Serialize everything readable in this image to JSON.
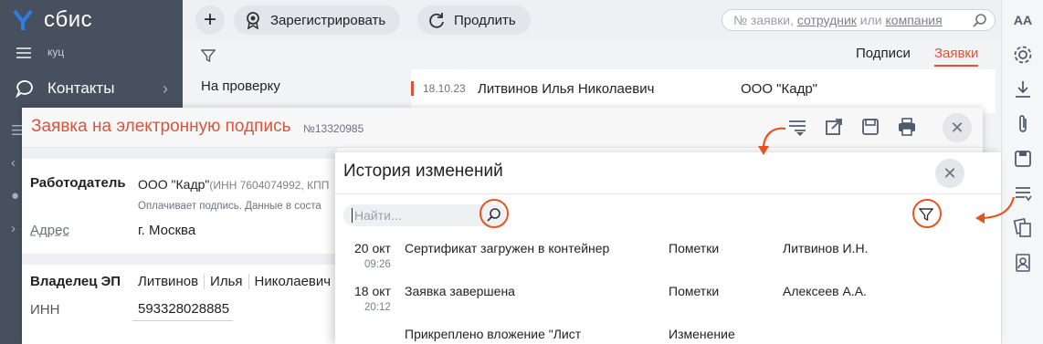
{
  "app": {
    "logo_text": "сбис",
    "menu_caption": "куц"
  },
  "nav": {
    "contacts_label": "Контакты"
  },
  "toolbar": {
    "register_label": "Зарегистрировать",
    "extend_label": "Продлить",
    "search_prefix": "№ заявки, ",
    "search_employee": "сотрудник",
    "search_or": " или ",
    "search_company": "компания"
  },
  "rail": {
    "font_label": "AA"
  },
  "background": {
    "left_filter_item": "На проверку",
    "tabs": [
      "Подписи",
      "Заявки"
    ],
    "active_tab": "Заявки",
    "row": {
      "date": "18.10.23",
      "name": "Литвинов Илья Николаевич",
      "company": "ООО \"Кадр\""
    }
  },
  "application": {
    "title": "Заявка на электронную подпись",
    "number": "№13320985",
    "employer_label": "Работодатель",
    "employer_value": "ООО \"Кадр\"",
    "employer_details": "(ИНН 7604074992, КПП",
    "employer_note": "Оплачивает подпись. Данные в соста",
    "address_label": "Адрес",
    "address_value": "г. Москва",
    "owner_label": "Владелец ЭП",
    "owner_last": "Литвинов",
    "owner_first": "Илья",
    "owner_middle": "Николаевич",
    "inn_label": "ИНН",
    "inn_value": "593328028885"
  },
  "history": {
    "title": "История изменений",
    "search_placeholder": "Найти...",
    "rows": [
      {
        "date": "20 окт",
        "time": "09:26",
        "event": "Сертификат загружен в контейнер",
        "kind": "Пометки",
        "author": "Литвинов И.Н."
      },
      {
        "date": "18 окт",
        "time": "20:12",
        "event": "Заявка завершена",
        "kind": "Пометки",
        "author": "Алексеев А.А."
      },
      {
        "date": "",
        "time": "",
        "event": "Прикреплено вложение \"Лист",
        "kind": "Изменение",
        "author": ""
      }
    ]
  },
  "colors": {
    "accent": "#d7563a",
    "annotation": "#e8541f",
    "nav_bg": "#46505f",
    "logo_blue": "#2f7de1"
  }
}
